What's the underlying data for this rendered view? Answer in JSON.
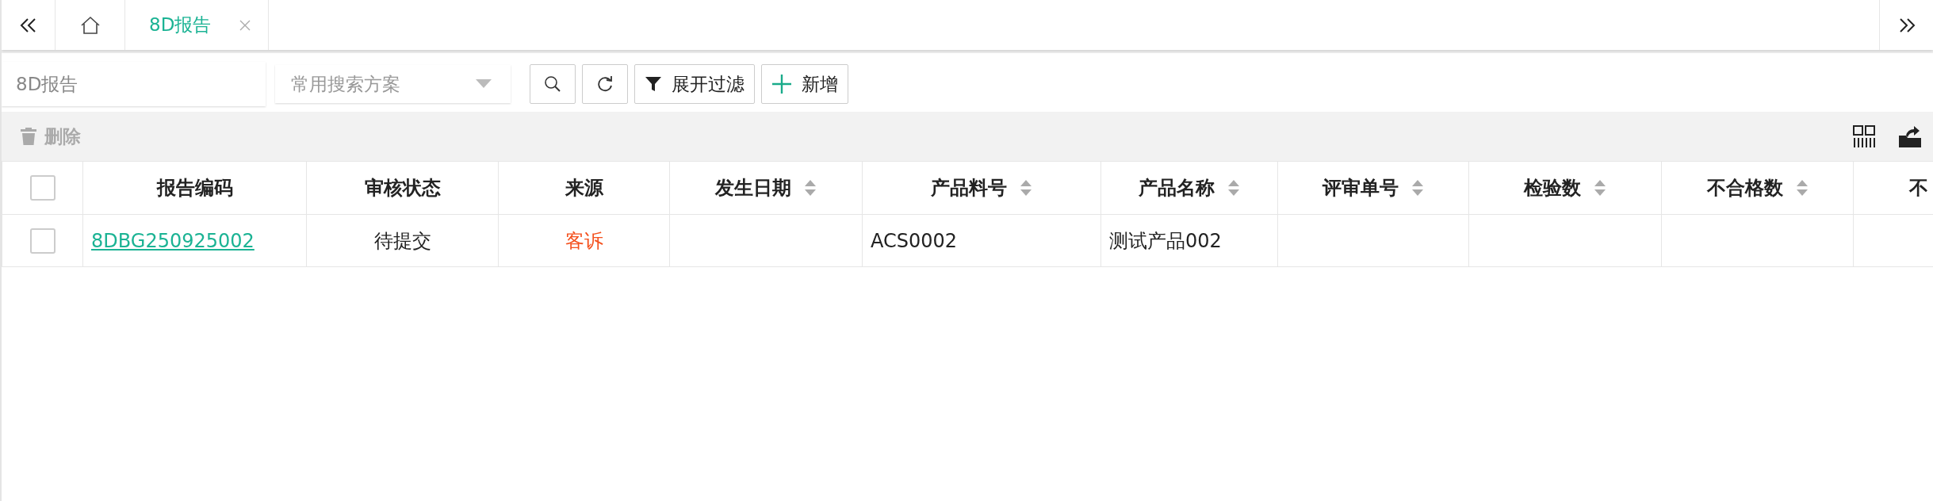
{
  "tabs": [
    {
      "kind": "home",
      "selected": false
    },
    {
      "kind": "page",
      "label": "8D报告",
      "selected": true,
      "closable": true
    }
  ],
  "toolbar": {
    "search": {
      "placeholder": "8D报告"
    },
    "scheme": {
      "placeholder": "常用搜索方案"
    },
    "filter_button": "展开过滤",
    "add_button": "新增"
  },
  "actions": {
    "delete": {
      "label": "删除",
      "disabled": true
    }
  },
  "table": {
    "header_checked": false,
    "columns": [
      {
        "label": "报告编码",
        "sortable": false
      },
      {
        "label": "审核状态",
        "sortable": false
      },
      {
        "label": "来源",
        "sortable": false
      },
      {
        "label": "发生日期",
        "sortable": true
      },
      {
        "label": "产品料号",
        "sortable": true
      },
      {
        "label": "产品名称",
        "sortable": true
      },
      {
        "label": "评审单号",
        "sortable": true
      },
      {
        "label": "检验数",
        "sortable": true
      },
      {
        "label": "不合格数",
        "sortable": true
      },
      {
        "label": "不",
        "sortable": false
      }
    ],
    "rows": [
      {
        "checked": false,
        "cells": [
          {
            "kind": "link",
            "text": "8DBG250925002"
          },
          {
            "kind": "status",
            "text": "待提交"
          },
          {
            "kind": "status",
            "text": "客诉",
            "color": "#f4511e"
          },
          null,
          {
            "kind": "text",
            "text": "ACS0002"
          },
          {
            "kind": "text",
            "text": "测试产品002"
          },
          null,
          null,
          null,
          null
        ]
      }
    ]
  }
}
